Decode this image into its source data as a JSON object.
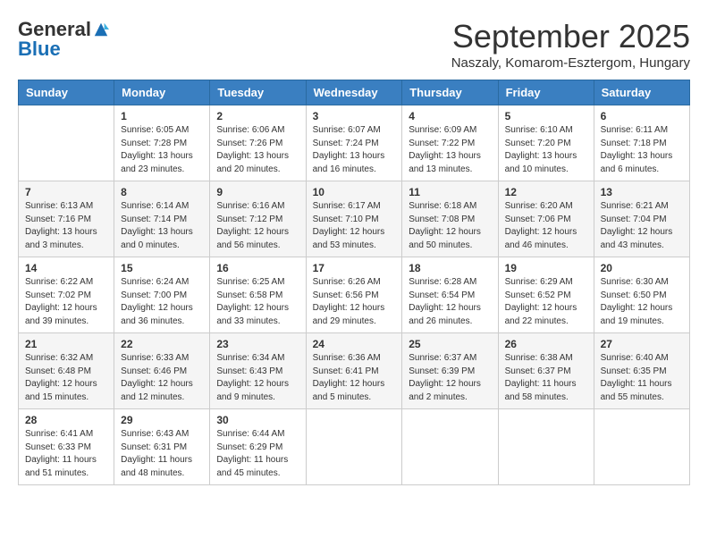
{
  "header": {
    "logo": {
      "general": "General",
      "blue": "Blue"
    },
    "title": "September 2025",
    "subtitle": "Naszaly, Komarom-Esztergom, Hungary"
  },
  "weekdays": [
    "Sunday",
    "Monday",
    "Tuesday",
    "Wednesday",
    "Thursday",
    "Friday",
    "Saturday"
  ],
  "weeks": [
    [
      {
        "day": "",
        "info": ""
      },
      {
        "day": "1",
        "info": "Sunrise: 6:05 AM\nSunset: 7:28 PM\nDaylight: 13 hours\nand 23 minutes."
      },
      {
        "day": "2",
        "info": "Sunrise: 6:06 AM\nSunset: 7:26 PM\nDaylight: 13 hours\nand 20 minutes."
      },
      {
        "day": "3",
        "info": "Sunrise: 6:07 AM\nSunset: 7:24 PM\nDaylight: 13 hours\nand 16 minutes."
      },
      {
        "day": "4",
        "info": "Sunrise: 6:09 AM\nSunset: 7:22 PM\nDaylight: 13 hours\nand 13 minutes."
      },
      {
        "day": "5",
        "info": "Sunrise: 6:10 AM\nSunset: 7:20 PM\nDaylight: 13 hours\nand 10 minutes."
      },
      {
        "day": "6",
        "info": "Sunrise: 6:11 AM\nSunset: 7:18 PM\nDaylight: 13 hours\nand 6 minutes."
      }
    ],
    [
      {
        "day": "7",
        "info": "Sunrise: 6:13 AM\nSunset: 7:16 PM\nDaylight: 13 hours\nand 3 minutes."
      },
      {
        "day": "8",
        "info": "Sunrise: 6:14 AM\nSunset: 7:14 PM\nDaylight: 13 hours\nand 0 minutes."
      },
      {
        "day": "9",
        "info": "Sunrise: 6:16 AM\nSunset: 7:12 PM\nDaylight: 12 hours\nand 56 minutes."
      },
      {
        "day": "10",
        "info": "Sunrise: 6:17 AM\nSunset: 7:10 PM\nDaylight: 12 hours\nand 53 minutes."
      },
      {
        "day": "11",
        "info": "Sunrise: 6:18 AM\nSunset: 7:08 PM\nDaylight: 12 hours\nand 50 minutes."
      },
      {
        "day": "12",
        "info": "Sunrise: 6:20 AM\nSunset: 7:06 PM\nDaylight: 12 hours\nand 46 minutes."
      },
      {
        "day": "13",
        "info": "Sunrise: 6:21 AM\nSunset: 7:04 PM\nDaylight: 12 hours\nand 43 minutes."
      }
    ],
    [
      {
        "day": "14",
        "info": "Sunrise: 6:22 AM\nSunset: 7:02 PM\nDaylight: 12 hours\nand 39 minutes."
      },
      {
        "day": "15",
        "info": "Sunrise: 6:24 AM\nSunset: 7:00 PM\nDaylight: 12 hours\nand 36 minutes."
      },
      {
        "day": "16",
        "info": "Sunrise: 6:25 AM\nSunset: 6:58 PM\nDaylight: 12 hours\nand 33 minutes."
      },
      {
        "day": "17",
        "info": "Sunrise: 6:26 AM\nSunset: 6:56 PM\nDaylight: 12 hours\nand 29 minutes."
      },
      {
        "day": "18",
        "info": "Sunrise: 6:28 AM\nSunset: 6:54 PM\nDaylight: 12 hours\nand 26 minutes."
      },
      {
        "day": "19",
        "info": "Sunrise: 6:29 AM\nSunset: 6:52 PM\nDaylight: 12 hours\nand 22 minutes."
      },
      {
        "day": "20",
        "info": "Sunrise: 6:30 AM\nSunset: 6:50 PM\nDaylight: 12 hours\nand 19 minutes."
      }
    ],
    [
      {
        "day": "21",
        "info": "Sunrise: 6:32 AM\nSunset: 6:48 PM\nDaylight: 12 hours\nand 15 minutes."
      },
      {
        "day": "22",
        "info": "Sunrise: 6:33 AM\nSunset: 6:46 PM\nDaylight: 12 hours\nand 12 minutes."
      },
      {
        "day": "23",
        "info": "Sunrise: 6:34 AM\nSunset: 6:43 PM\nDaylight: 12 hours\nand 9 minutes."
      },
      {
        "day": "24",
        "info": "Sunrise: 6:36 AM\nSunset: 6:41 PM\nDaylight: 12 hours\nand 5 minutes."
      },
      {
        "day": "25",
        "info": "Sunrise: 6:37 AM\nSunset: 6:39 PM\nDaylight: 12 hours\nand 2 minutes."
      },
      {
        "day": "26",
        "info": "Sunrise: 6:38 AM\nSunset: 6:37 PM\nDaylight: 11 hours\nand 58 minutes."
      },
      {
        "day": "27",
        "info": "Sunrise: 6:40 AM\nSunset: 6:35 PM\nDaylight: 11 hours\nand 55 minutes."
      }
    ],
    [
      {
        "day": "28",
        "info": "Sunrise: 6:41 AM\nSunset: 6:33 PM\nDaylight: 11 hours\nand 51 minutes."
      },
      {
        "day": "29",
        "info": "Sunrise: 6:43 AM\nSunset: 6:31 PM\nDaylight: 11 hours\nand 48 minutes."
      },
      {
        "day": "30",
        "info": "Sunrise: 6:44 AM\nSunset: 6:29 PM\nDaylight: 11 hours\nand 45 minutes."
      },
      {
        "day": "",
        "info": ""
      },
      {
        "day": "",
        "info": ""
      },
      {
        "day": "",
        "info": ""
      },
      {
        "day": "",
        "info": ""
      }
    ]
  ]
}
